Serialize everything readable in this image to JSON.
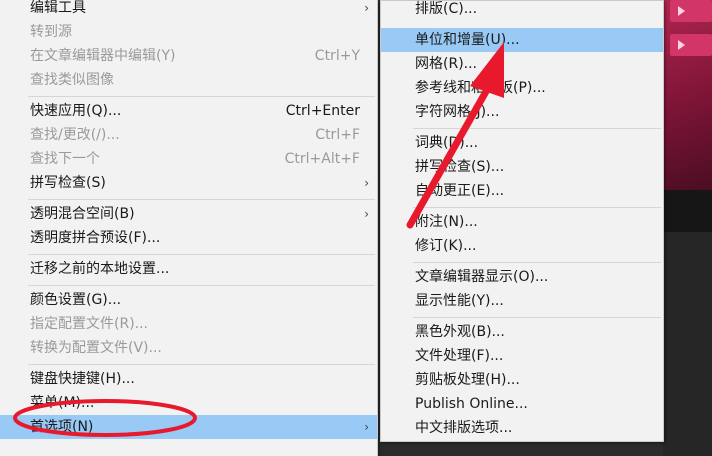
{
  "menu1": {
    "items": [
      {
        "label": "编辑工具",
        "shortcut": "",
        "submenu": true,
        "disabled": false
      },
      {
        "label": "转到源",
        "shortcut": "",
        "submenu": false,
        "disabled": true
      },
      {
        "label": "在文章编辑器中编辑(Y)",
        "shortcut": "Ctrl+Y",
        "submenu": false,
        "disabled": true
      },
      {
        "label": "查找类似图像",
        "shortcut": "",
        "submenu": false,
        "disabled": true
      },
      {
        "label": "快速应用(Q)...",
        "shortcut": "Ctrl+Enter",
        "submenu": false,
        "disabled": false
      },
      {
        "label": "查找/更改(/)...",
        "shortcut": "Ctrl+F",
        "submenu": false,
        "disabled": true
      },
      {
        "label": "查找下一个",
        "shortcut": "Ctrl+Alt+F",
        "submenu": false,
        "disabled": true
      },
      {
        "label": "拼写检查(S)",
        "shortcut": "",
        "submenu": true,
        "disabled": false
      },
      {
        "label": "透明混合空间(B)",
        "shortcut": "",
        "submenu": true,
        "disabled": false
      },
      {
        "label": "透明度拼合预设(F)...",
        "shortcut": "",
        "submenu": false,
        "disabled": false
      },
      {
        "label": "迁移之前的本地设置...",
        "shortcut": "",
        "submenu": false,
        "disabled": false
      },
      {
        "label": "颜色设置(G)...",
        "shortcut": "",
        "submenu": false,
        "disabled": false
      },
      {
        "label": "指定配置文件(R)...",
        "shortcut": "",
        "submenu": false,
        "disabled": true
      },
      {
        "label": "转换为配置文件(V)...",
        "shortcut": "",
        "submenu": false,
        "disabled": true
      },
      {
        "label": "键盘快捷键(H)...",
        "shortcut": "",
        "submenu": false,
        "disabled": false
      },
      {
        "label": "菜单(M)...",
        "shortcut": "",
        "submenu": false,
        "disabled": false
      },
      {
        "label": "首选项(N)",
        "shortcut": "",
        "submenu": true,
        "disabled": false,
        "highlighted": true
      }
    ]
  },
  "menu2": {
    "items": [
      {
        "label": "排版(C)..."
      },
      {
        "label": "单位和增量(U)...",
        "highlighted": true
      },
      {
        "label": "网格(R)..."
      },
      {
        "label": "参考线和粘贴板(P)..."
      },
      {
        "label": "字符网格(J)..."
      },
      {
        "label": "词典(D)..."
      },
      {
        "label": "拼写检查(S)..."
      },
      {
        "label": "自动更正(E)..."
      },
      {
        "label": "附注(N)..."
      },
      {
        "label": "修订(K)..."
      },
      {
        "label": "文章编辑器显示(O)..."
      },
      {
        "label": "显示性能(Y)..."
      },
      {
        "label": "黑色外观(B)..."
      },
      {
        "label": "文件处理(F)..."
      },
      {
        "label": "剪贴板处理(H)..."
      },
      {
        "label": "Publish Online..."
      },
      {
        "label": "中文排版选项..."
      }
    ]
  },
  "colors": {
    "highlight": "#99c9f5",
    "annotation": "#e8192c",
    "menu_bg": "#f2f2f2",
    "accent_pink": "#d23567"
  },
  "glyphs": {
    "submenu_arrow": "›"
  }
}
